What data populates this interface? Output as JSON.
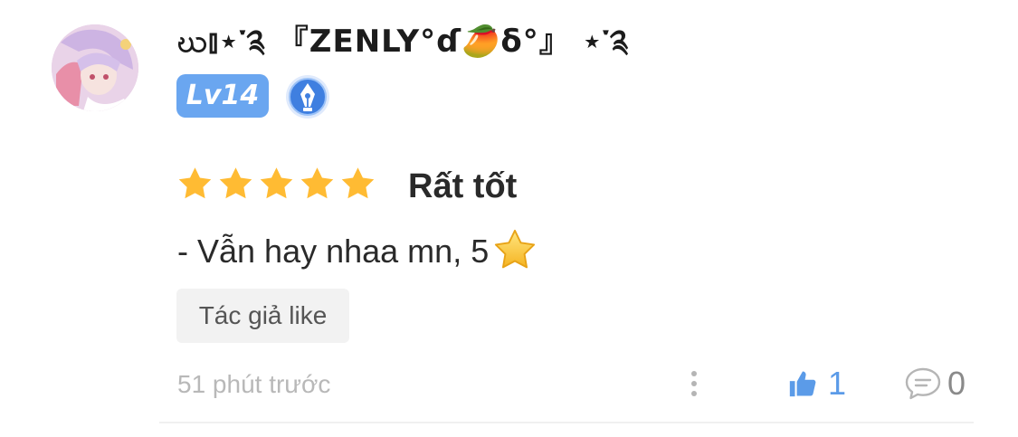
{
  "user": {
    "name": "ဃ⫾⋆་༉ 『ZENLY°ɗ🥭δ°』 ⋆་༉",
    "level": "Lv14"
  },
  "rating": {
    "stars": 5,
    "max_stars": 5,
    "label": "Rất tốt"
  },
  "comment": {
    "text": "- Vẫn hay nhaa mn, 5",
    "emoji": "star-emoji"
  },
  "tags": {
    "author_like": "Tác giả like"
  },
  "meta": {
    "timestamp": "51 phút trước",
    "like_count": "1",
    "comment_count": "0"
  },
  "icons": {
    "star": "star-icon",
    "more": "more-vertical-icon",
    "like": "thumbs-up-icon",
    "comment": "comment-bubble-icon",
    "badge": "pen-nib-badge-icon"
  },
  "colors": {
    "star": "#ffbb33",
    "level_badge": "#6aa6f0",
    "like_active": "#5b9be8",
    "muted": "#b8b8b8"
  }
}
